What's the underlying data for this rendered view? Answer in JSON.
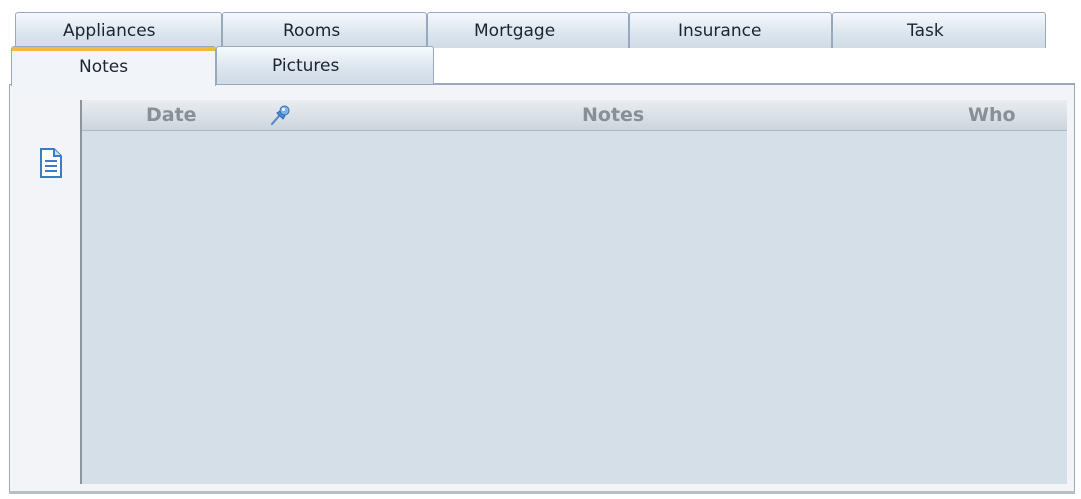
{
  "tabs_back": [
    {
      "label": "Appliances"
    },
    {
      "label": "Rooms"
    },
    {
      "label": "Mortgage"
    },
    {
      "label": "Insurance"
    },
    {
      "label": "Task"
    }
  ],
  "tabs_front": [
    {
      "label": "Notes",
      "active": true
    },
    {
      "label": "Pictures",
      "active": false
    }
  ],
  "grid": {
    "columns": [
      {
        "label": "Date"
      },
      {
        "label": "",
        "icon": "pin-icon"
      },
      {
        "label": "Notes"
      },
      {
        "label": "Who"
      }
    ],
    "rows": []
  },
  "side_icon": "note-document-icon",
  "colors": {
    "active_tab_accent": "#f3b93b",
    "grid_background": "#d5dfe8",
    "header_text": "#8a8f95"
  }
}
